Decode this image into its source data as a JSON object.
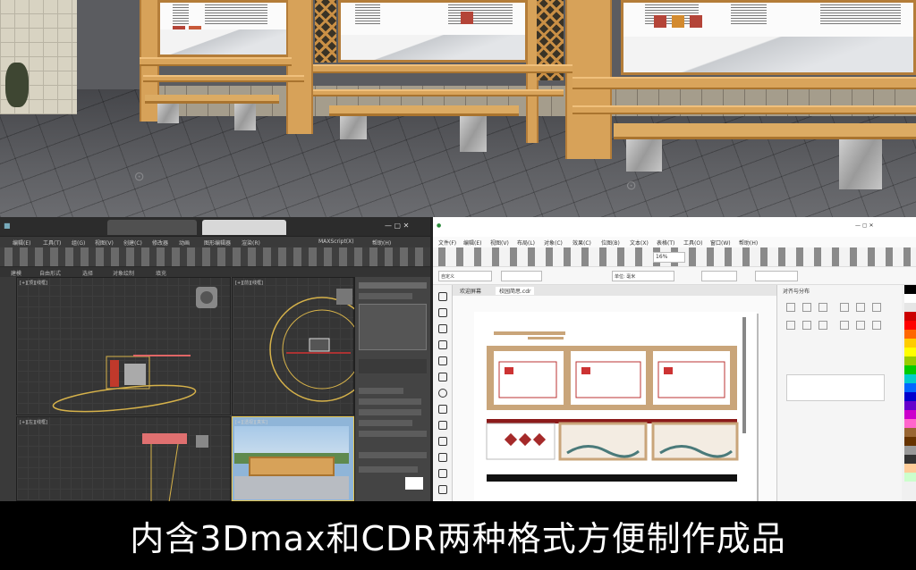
{
  "caption": "内含3Dmax和CDR两种格式方便制作成品",
  "max_window": {
    "menus": [
      "编辑(E)",
      "工具(T)",
      "组(G)",
      "视图(V)",
      "创建(C)",
      "修改器",
      "动画",
      "图形编辑器",
      "渲染(R)",
      "MAXScript(X)",
      "帮助(H)"
    ],
    "ribbon": [
      "建模",
      "自由形式",
      "选择",
      "对象绘制",
      "填充"
    ],
    "viewport_labels": [
      "[+][顶][线框]",
      "[+][前][线框]",
      "[+][左][线框]",
      "[+][透视][真实]"
    ]
  },
  "cdr_window": {
    "menus": [
      "文件(F)",
      "编辑(E)",
      "视图(V)",
      "布局(L)",
      "对象(C)",
      "效果(C)",
      "位图(B)",
      "文本(X)",
      "表格(T)",
      "工具(O)",
      "窗口(W)",
      "帮助(H)"
    ],
    "doc_tabs": [
      "欢迎屏幕",
      "校园简思.cdr"
    ],
    "docker_title": "对齐与分布",
    "zoom": "16%",
    "preset": "自定义",
    "units_label": "单位: 毫米",
    "palette_colors": [
      "#000000",
      "#ffffff",
      "#e6e6e6",
      "#cc0000",
      "#ff0000",
      "#ff6600",
      "#ffcc00",
      "#ffff00",
      "#99cc00",
      "#00cc00",
      "#00cccc",
      "#0066ff",
      "#0000cc",
      "#6600cc",
      "#cc00cc",
      "#ff66cc",
      "#996633",
      "#663300",
      "#999999",
      "#333333",
      "#ffcc99",
      "#ccffcc"
    ]
  }
}
